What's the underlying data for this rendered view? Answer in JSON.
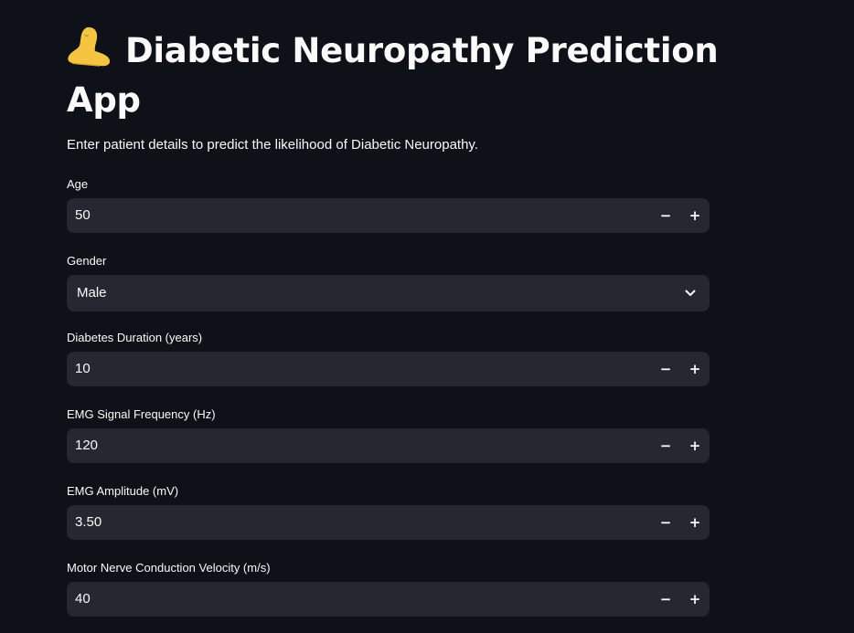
{
  "app": {
    "title_emoji_icon": "foot-icon",
    "title": "Diabetic Neuropathy Prediction App",
    "subtitle": "Enter patient details to predict the likelihood of Diabetic Neuropathy."
  },
  "form": {
    "age": {
      "label": "Age",
      "value": "50"
    },
    "gender": {
      "label": "Gender",
      "value": "Male"
    },
    "diabetes_duration": {
      "label": "Diabetes Duration (years)",
      "value": "10"
    },
    "emg_frequency": {
      "label": "EMG Signal Frequency (Hz)",
      "value": "120"
    },
    "emg_amplitude": {
      "label": "EMG Amplitude (mV)",
      "value": "3.50"
    },
    "motor_ncv": {
      "label": "Motor Nerve Conduction Velocity (m/s)",
      "value": "40"
    },
    "stepper": {
      "minus": "−",
      "plus": "+"
    }
  },
  "theme": {
    "background": "#0e1117",
    "input_background": "#262730",
    "text": "#fafafa"
  }
}
